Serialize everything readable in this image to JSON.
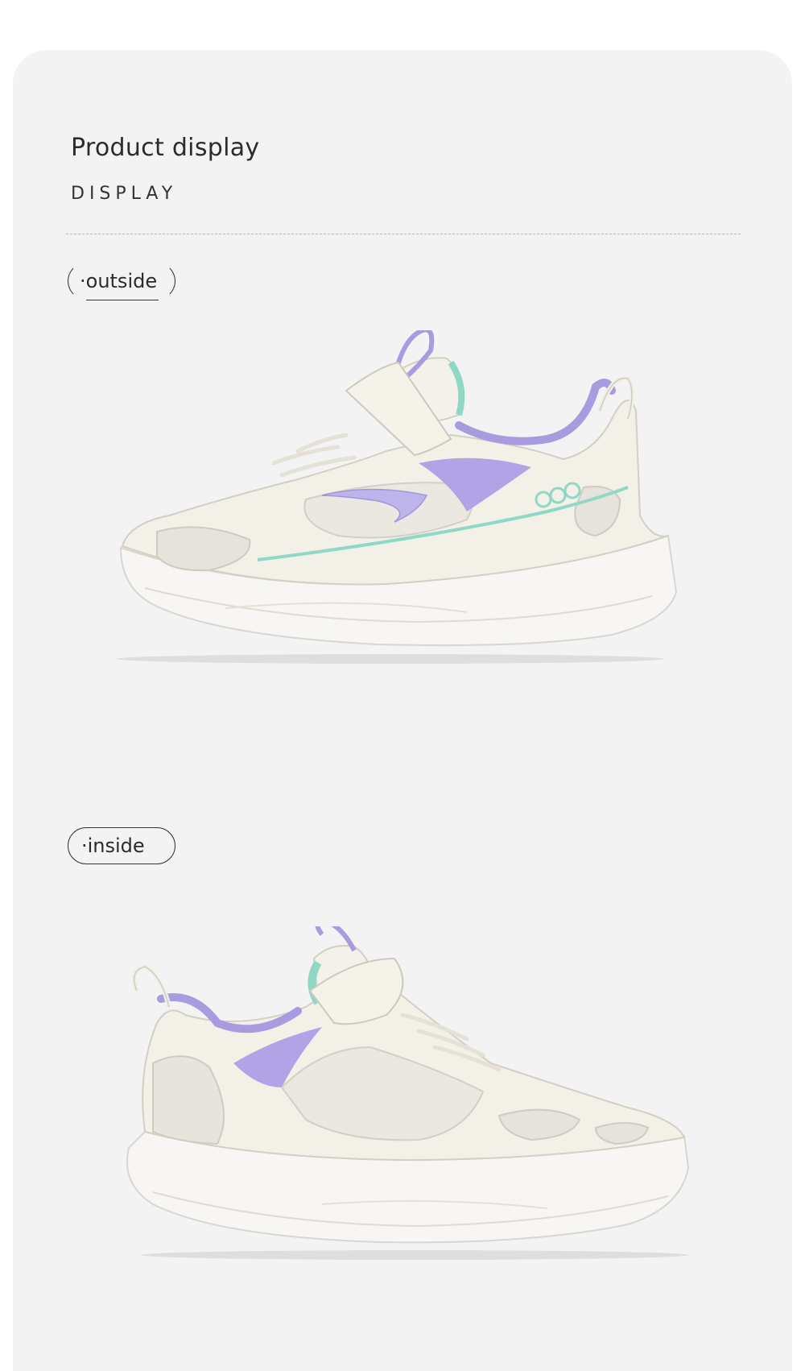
{
  "header": {
    "title": "Product display",
    "subtitle": "DISPLAY"
  },
  "views": [
    {
      "label": "·outside",
      "image": "sneaker-outside-view"
    },
    {
      "label": "·inside",
      "image": "sneaker-inside-view"
    }
  ],
  "colors": {
    "card_background": "#f3f3f4",
    "shoe_body": "#f2efe6",
    "shoe_accent_purple": "#a99be0",
    "shoe_accent_mint": "#8fd8c6"
  }
}
